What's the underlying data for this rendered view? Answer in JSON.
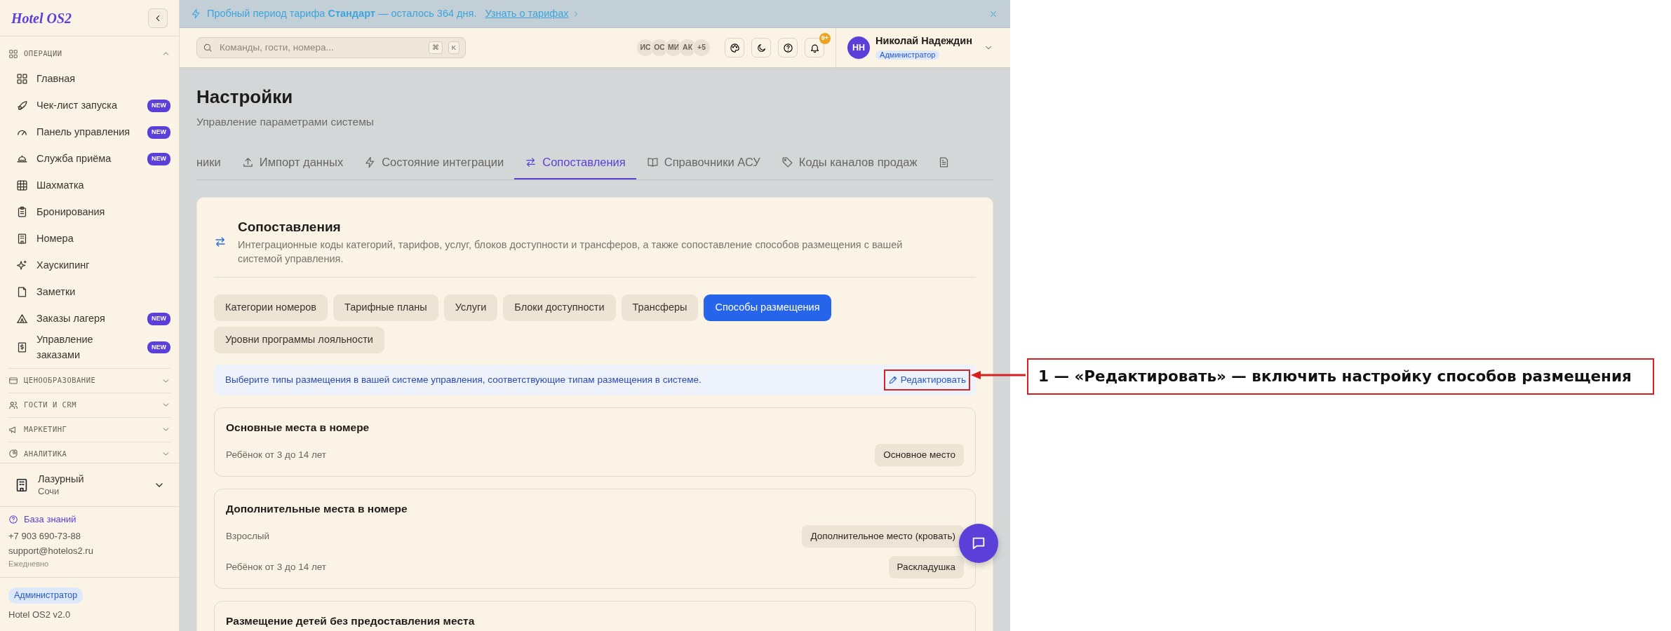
{
  "sidebar": {
    "logo": "Hotel OS2",
    "sections": [
      {
        "title": "ОПЕРАЦИИ",
        "expanded": true,
        "items": [
          {
            "label": "Главная"
          },
          {
            "label": "Чек-лист запуска",
            "badge": "NEW"
          },
          {
            "label": "Панель управления",
            "badge": "NEW"
          },
          {
            "label": "Служба приёма",
            "badge": "NEW"
          },
          {
            "label": "Шахматка"
          },
          {
            "label": "Бронирования"
          },
          {
            "label": "Номера"
          },
          {
            "label": "Хаускипинг"
          },
          {
            "label": "Заметки"
          },
          {
            "label": "Заказы лагеря",
            "badge": "NEW"
          },
          {
            "label": "Управление заказами",
            "badge": "NEW"
          }
        ]
      },
      {
        "title": "ЦЕНООБРАЗОВАНИЕ",
        "expanded": false
      },
      {
        "title": "ГОСТИ И CRM",
        "expanded": false
      },
      {
        "title": "МАРКЕТИНГ",
        "expanded": false
      },
      {
        "title": "АНАЛИТИКА",
        "expanded": false
      }
    ],
    "hotel": {
      "name": "Лазурный",
      "city": "Сочи"
    },
    "help": {
      "link": "База знаний",
      "phone": "+7 903 690-73-88",
      "email": "support@hotelos2.ru",
      "hours": "Ежедневно"
    },
    "role": "Администратор",
    "version": "Hotel OS2 v2.0"
  },
  "banner": {
    "text": "Пробный период тарифа **Стандарт** — осталось 364 дня.",
    "link": "Узнать о тарифах"
  },
  "header": {
    "search": {
      "placeholder": "Команды, гости, номера...",
      "keys": [
        "⌘",
        "K"
      ]
    },
    "avatars": [
      "ИС",
      "ОС",
      "МИ",
      "АК"
    ],
    "more": "+5",
    "notifications": "9+",
    "user": {
      "initials": "НН",
      "name": "Николай Надеждин",
      "role": "Администратор"
    }
  },
  "page": {
    "title": "Настройки",
    "subtitle": "Управление параметрами системы",
    "tabs": [
      {
        "label": "ники",
        "selected": false
      },
      {
        "label": "Импорт данных",
        "selected": false
      },
      {
        "label": "Состояние интеграции",
        "selected": false
      },
      {
        "label": "Сопоставления",
        "selected": true
      },
      {
        "label": "Справочники АСУ",
        "selected": false
      },
      {
        "label": "Коды каналов продаж",
        "selected": false
      },
      {
        "selected": false
      }
    ],
    "card": {
      "title": "Сопоставления",
      "description": "Интеграционные коды категорий, тарифов, услуг, блоков доступности и трансферов, а также сопоставление способов размещения с вашей системой управления.",
      "pills": [
        {
          "label": "Категории номеров",
          "selected": false
        },
        {
          "label": "Тарифные планы",
          "selected": false
        },
        {
          "label": "Услуги",
          "selected": false
        },
        {
          "label": "Блоки доступности",
          "selected": false
        },
        {
          "label": "Трансферы",
          "selected": false
        },
        {
          "label": "Способы размещения",
          "selected": true
        },
        {
          "label": "Уровни программы лояльности",
          "selected": false
        }
      ],
      "info": "Выберите типы размещения в вашей системе управления, соответствующие типам размещения в системе.",
      "edit": {
        "label": "Редактировать",
        "highlighted": true
      },
      "groups": [
        {
          "title": "Основные места в номере",
          "rows": [
            {
              "label": "Ребёнок от 3 до 14 лет",
              "value": "Основное место"
            }
          ]
        },
        {
          "title": "Дополнительные места в номере",
          "rows": [
            {
              "label": "Взрослый",
              "value": "Дополнительное место (кровать)"
            },
            {
              "label": "Ребёнок от 3 до 14 лет",
              "value": "Раскладушка"
            }
          ]
        },
        {
          "title": "Размещение детей без предоставления места"
        }
      ]
    }
  },
  "annotation": {
    "text": "1 — «Редактировать» — включить настройку способов размещения"
  }
}
